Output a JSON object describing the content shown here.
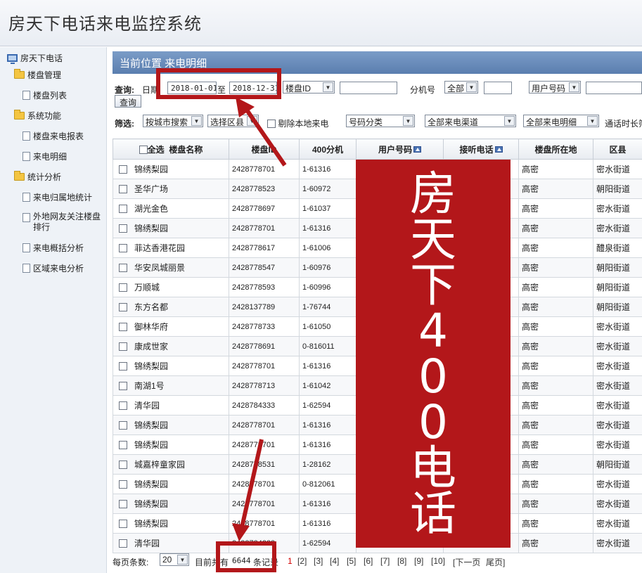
{
  "app": {
    "title": "房天下电话来电监控系统"
  },
  "sidebar": {
    "root": "房天下电话",
    "items": [
      {
        "type": "group",
        "label": "楼盘管理"
      },
      {
        "type": "page",
        "label": "楼盘列表"
      },
      {
        "type": "group",
        "label": "系统功能"
      },
      {
        "type": "page",
        "label": "楼盘来电报表"
      },
      {
        "type": "page",
        "label": "来电明细"
      },
      {
        "type": "group",
        "label": "统计分析"
      },
      {
        "type": "page",
        "label": "来电归属地统计"
      },
      {
        "type": "page",
        "label": "外地网友关注楼盘排行"
      },
      {
        "type": "page",
        "label": "来电概括分析"
      },
      {
        "type": "page",
        "label": "区域来电分析"
      }
    ]
  },
  "location": {
    "text": "当前位置 来电明细"
  },
  "query": {
    "label": "查询:",
    "date_label": "日期",
    "start_date": "2018-01-01",
    "to_label": "至",
    "end_date": "2018-12-31",
    "building_field": "楼盘ID",
    "building_value": "",
    "ext_label": "分机号",
    "ext_scope": "全部",
    "ext_value": "",
    "user_field": "用户号码",
    "user_value": "",
    "search_button": "查询"
  },
  "filter": {
    "label": "筛选:",
    "city": "按城市搜索",
    "district": "选择区县",
    "exclude_local": "剔除本地来电",
    "number_category": "号码分类",
    "channel": "全部来电渠道",
    "detail": "全部来电明细",
    "duration_label": "通话时长筛"
  },
  "table": {
    "select_all": "全选",
    "headers": [
      "楼盘名称",
      "楼盘ID",
      "400分机",
      "用户号码",
      "接听电话",
      "楼盘所在地",
      "区县"
    ],
    "rows": [
      [
        "锦绣梨园",
        "2428778701",
        "1-61316",
        "高密",
        "密水街道"
      ],
      [
        "圣华广场",
        "2428778523",
        "1-60972",
        "高密",
        "朝阳街道"
      ],
      [
        "湖光金色",
        "2428778697",
        "1-61037",
        "高密",
        "密水街道"
      ],
      [
        "锦绣梨园",
        "2428778701",
        "1-61316",
        "高密",
        "密水街道"
      ],
      [
        "菲达香港花园",
        "2428778617",
        "1-61006",
        "高密",
        "醴泉街道"
      ],
      [
        "华安凤城丽景",
        "2428778547",
        "1-60976",
        "高密",
        "朝阳街道"
      ],
      [
        "万顺城",
        "2428778593",
        "1-60996",
        "高密",
        "朝阳街道"
      ],
      [
        "东方名都",
        "2428137789",
        "1-76744",
        "高密",
        "朝阳街道"
      ],
      [
        "御林华府",
        "2428778733",
        "1-61050",
        "高密",
        "密水街道"
      ],
      [
        "康成世家",
        "2428778691",
        "0-816011",
        "高密",
        "密水街道"
      ],
      [
        "锦绣梨园",
        "2428778701",
        "1-61316",
        "高密",
        "密水街道"
      ],
      [
        "南湖1号",
        "2428778713",
        "1-61042",
        "高密",
        "密水街道"
      ],
      [
        "清华园",
        "2428784333",
        "1-62594",
        "高密",
        "密水街道"
      ],
      [
        "锦绣梨园",
        "2428778701",
        "1-61316",
        "高密",
        "密水街道"
      ],
      [
        "锦绣梨园",
        "2428778701",
        "1-61316",
        "高密",
        "密水街道"
      ],
      [
        "城嘉梓童家园",
        "2428778531",
        "1-28162",
        "高密",
        "朝阳街道"
      ],
      [
        "锦绣梨园",
        "2428778701",
        "0-812061",
        "高密",
        "密水街道"
      ],
      [
        "锦绣梨园",
        "2428778701",
        "1-61316",
        "高密",
        "密水街道"
      ],
      [
        "锦绣梨园",
        "2428778701",
        "1-61316",
        "高密",
        "密水街道"
      ],
      [
        "清华园",
        "2428784333",
        "1-62594",
        "高密",
        "密水街道"
      ]
    ]
  },
  "overlay": {
    "text": [
      "房",
      "天",
      "下",
      "4",
      "0",
      "0",
      "电",
      "话"
    ],
    "color": "#b3171a"
  },
  "footer": {
    "page_size_label": "每页条数:",
    "page_size": "20",
    "total_prefix": "目前共有",
    "total_count": "6644",
    "total_suffix": "条记录",
    "current_page": "1",
    "pages": [
      "[2]",
      "[3]",
      "[4]",
      "[5]",
      "[6]",
      "[7]",
      "[8]",
      "[9]",
      "[10]"
    ],
    "next": "[下一页",
    "last": "尾页]"
  },
  "colors": {
    "header_bar": "#5a7eaf",
    "annotation_red": "#b3171a",
    "sidebar_bg": "#eef2f7"
  }
}
